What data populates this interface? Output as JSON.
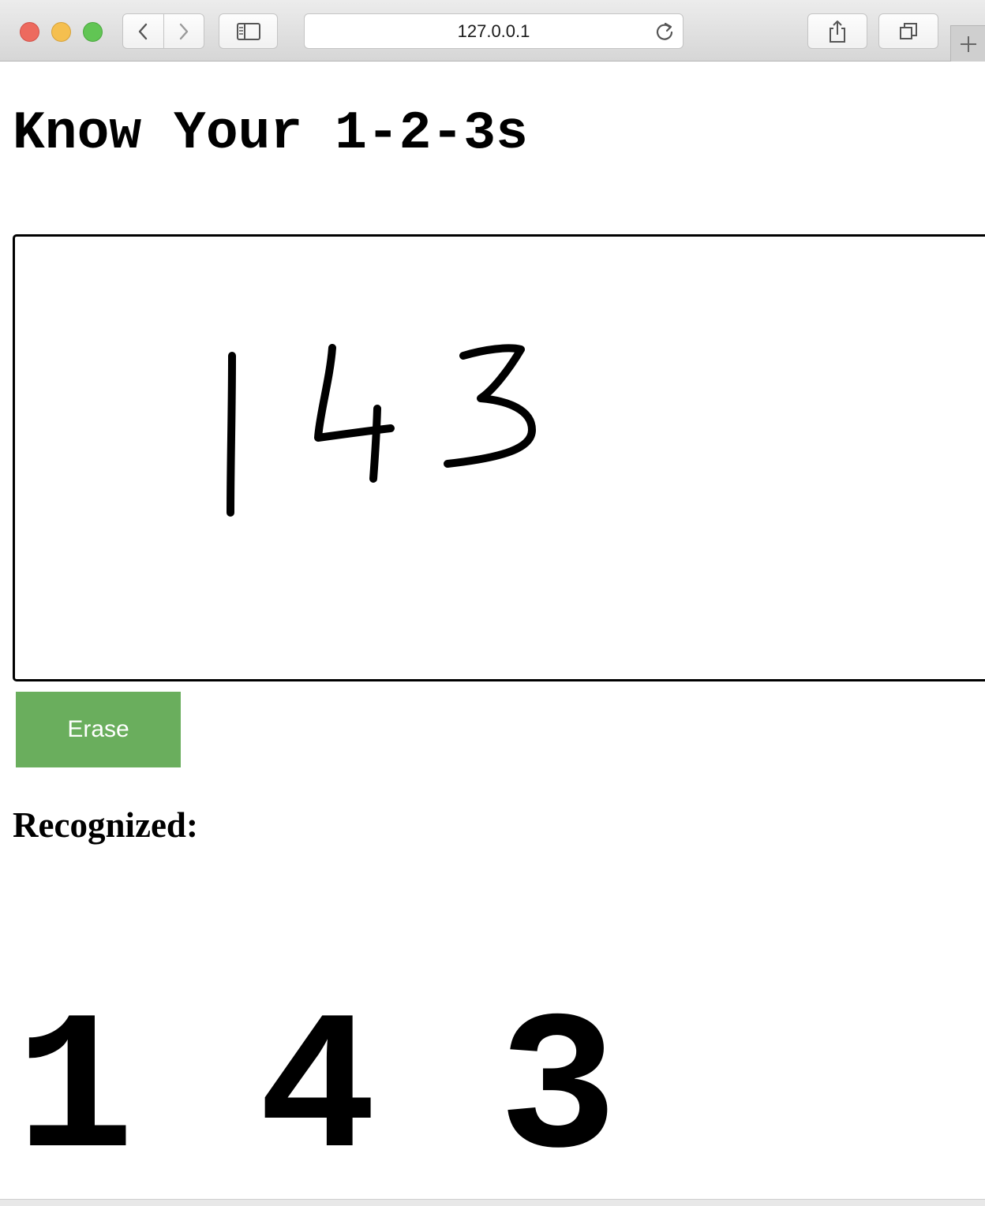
{
  "browser": {
    "url": "127.0.0.1",
    "icons": {
      "back": "chevron-left-icon",
      "forward": "chevron-right-icon",
      "sidebar": "sidebar-icon",
      "reload": "reload-icon",
      "share": "share-icon",
      "tabs": "tabs-icon",
      "new_tab": "plus-icon"
    }
  },
  "page": {
    "title": "Know Your 1-2-3s",
    "erase_label": "Erase",
    "recognized_label": "Recognized:",
    "recognized_digits": [
      "1",
      "4",
      "3"
    ],
    "colors": {
      "erase_button": "#6aae5d",
      "ink": "#000000"
    }
  }
}
